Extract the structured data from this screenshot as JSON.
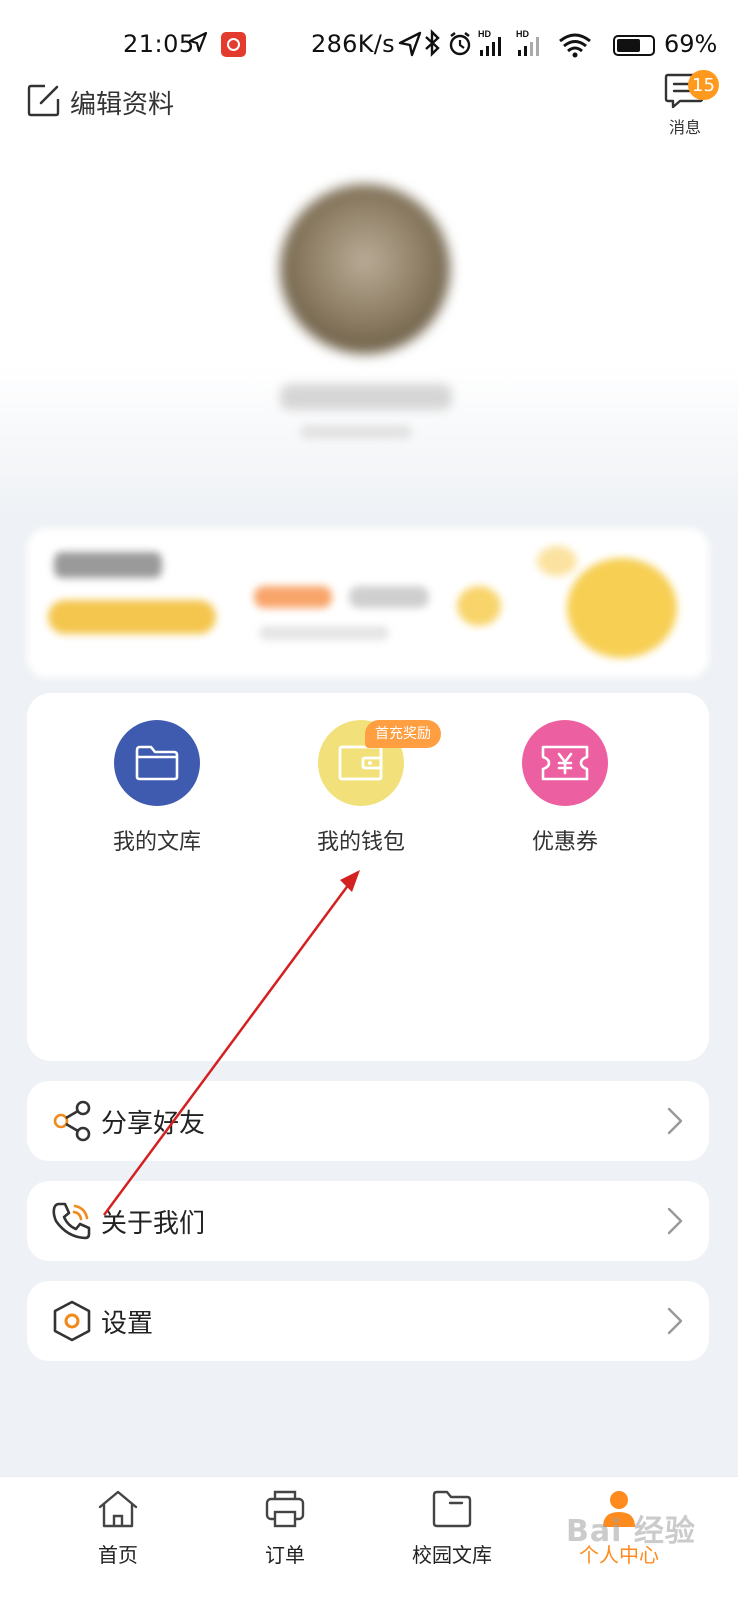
{
  "status_bar": {
    "time": "21:05",
    "net_speed": "286K/s",
    "battery_pct": "69%",
    "battery_level": 0.69
  },
  "header": {
    "edit_profile": "编辑资料",
    "messages_label": "消息",
    "messages_count": "15"
  },
  "services": {
    "items": [
      {
        "label": "我的文库",
        "icon": "folder-icon",
        "color": "#3f5bb0"
      },
      {
        "label": "我的钱包",
        "icon": "wallet-icon",
        "color": "#f2e07a",
        "tag": "首充奖励"
      },
      {
        "label": "优惠券",
        "icon": "coupon-icon",
        "color": "#ec5fa0"
      }
    ]
  },
  "menu": {
    "share": "分享好友",
    "about": "关于我们",
    "settings": "设置"
  },
  "bottom_nav": {
    "home": "首页",
    "orders": "订单",
    "campus_library": "校园文库",
    "profile": "个人中心",
    "active_color": "#ff8a1e"
  },
  "watermark": "Bai 经验",
  "colors": {
    "accent": "#ff9a1f",
    "annotation": "#d42020"
  }
}
